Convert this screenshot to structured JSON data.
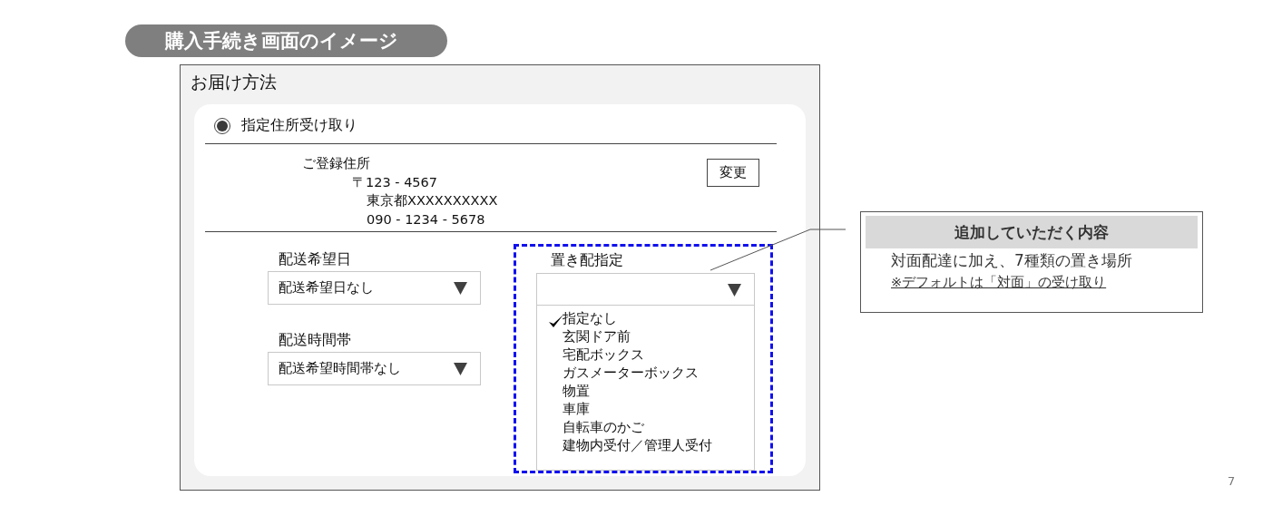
{
  "slide": {
    "heading": "購入手続き画面のイメージ",
    "page_number": "7"
  },
  "panel": {
    "title": "お届け方法",
    "delivery_option": {
      "label": "指定住所受け取り",
      "selected": true
    },
    "address": {
      "heading": "ご登録住所",
      "postal_code": "〒123 - 4567",
      "street": "東京都XXXXXXXXXX",
      "phone": "090 - 1234 - 5678",
      "change_button": "変更"
    },
    "delivery_date": {
      "label": "配送希望日",
      "value": "配送希望日なし"
    },
    "delivery_time": {
      "label": "配送時間帯",
      "value": "配送希望時間帯なし"
    },
    "drop_off": {
      "label": "置き配指定",
      "expanded": true,
      "options": [
        {
          "label": "指定なし",
          "selected": true
        },
        {
          "label": "玄関ドア前",
          "selected": false
        },
        {
          "label": "宅配ボックス",
          "selected": false
        },
        {
          "label": "ガスメーターボックス",
          "selected": false
        },
        {
          "label": "物置",
          "selected": false
        },
        {
          "label": "車庫",
          "selected": false
        },
        {
          "label": "自転車のかご",
          "selected": false
        },
        {
          "label": "建物内受付／管理人受付",
          "selected": false
        }
      ]
    }
  },
  "callout": {
    "title": "追加していただく内容",
    "text": "対面配達に加え、7種類の置き場所",
    "note": "※デフォルトは「対面」の受け取り"
  }
}
